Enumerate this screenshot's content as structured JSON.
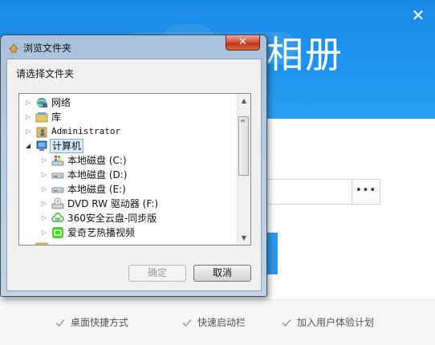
{
  "installer": {
    "close_glyph": "✕",
    "title_fragment": "相册",
    "browse_label": "•••",
    "options": [
      {
        "label": "桌面快捷方式",
        "checked": true
      },
      {
        "label": "快速启动栏",
        "checked": true
      },
      {
        "label": "加入用户体验计划",
        "checked": true
      }
    ],
    "accent_color": "#1f95ee"
  },
  "dialog": {
    "title": "浏览文件夹",
    "close_glyph": "✕",
    "prompt": "请选择文件夹",
    "tree": [
      {
        "label": "网络",
        "icon": "network-icon",
        "expanded": false,
        "level": 0
      },
      {
        "label": "库",
        "icon": "library-icon",
        "expanded": false,
        "level": 0
      },
      {
        "label": "Administrator",
        "icon": "user-folder-icon",
        "expanded": false,
        "level": 0
      },
      {
        "label": "计算机",
        "icon": "computer-icon",
        "expanded": true,
        "level": 0,
        "selected": true
      },
      {
        "label": "本地磁盘 (C:)",
        "icon": "system-drive-icon",
        "expanded": false,
        "level": 1
      },
      {
        "label": "本地磁盘 (D:)",
        "icon": "drive-icon",
        "expanded": false,
        "level": 1
      },
      {
        "label": "本地磁盘 (E:)",
        "icon": "drive-icon",
        "expanded": false,
        "level": 1
      },
      {
        "label": "DVD RW 驱动器 (F:)",
        "icon": "dvd-drive-icon",
        "expanded": false,
        "level": 1
      },
      {
        "label": "360安全云盘-同步版",
        "icon": "cloud-drive-icon",
        "expanded": false,
        "level": 1
      },
      {
        "label": "爱奇艺热播视频",
        "icon": "iqiyi-icon",
        "expanded": false,
        "level": 1
      }
    ],
    "ok_label": "确定",
    "cancel_label": "取消"
  }
}
